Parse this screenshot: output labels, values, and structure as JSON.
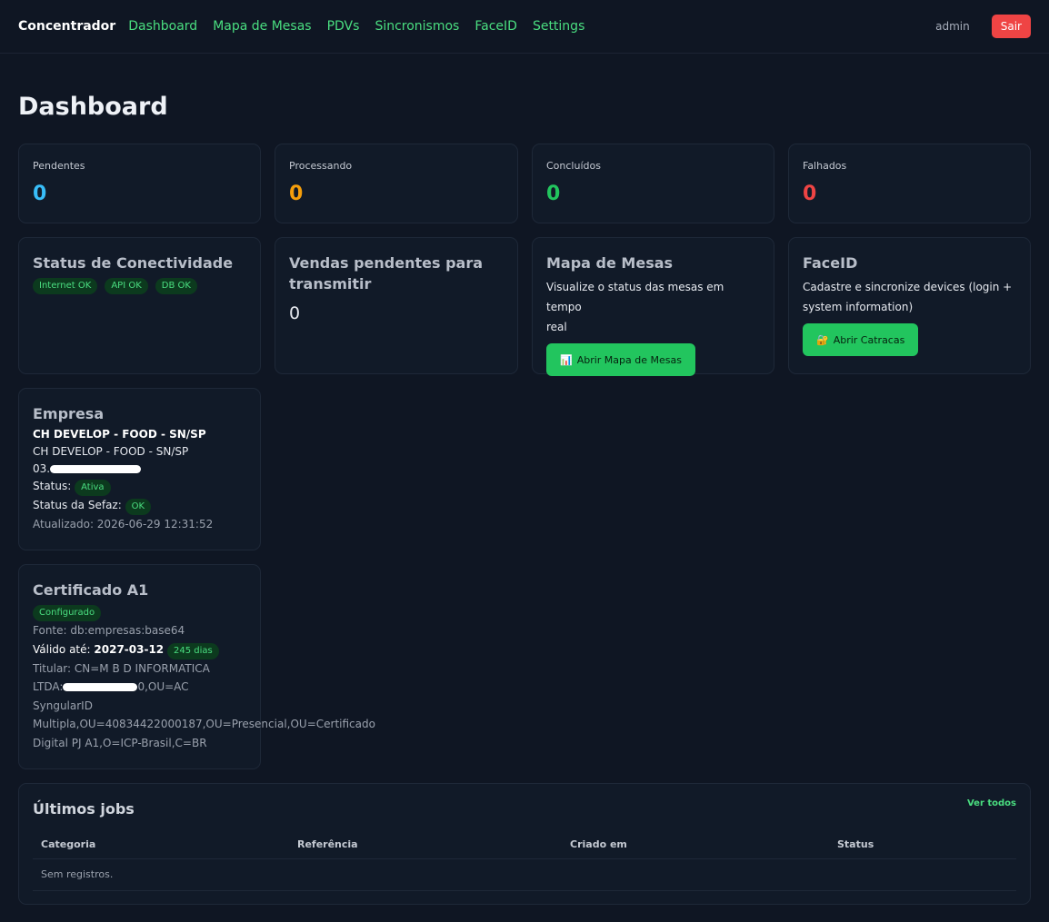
{
  "navbar": {
    "brand": "Concentrador",
    "links": [
      "Dashboard",
      "Mapa de Mesas",
      "PDVs",
      "Sincronismos",
      "FaceID",
      "Settings"
    ],
    "user": "admin",
    "logout_label": "Sair"
  },
  "page_title": "Dashboard",
  "stats": [
    {
      "label": "Pendentes",
      "value": "0",
      "color": "#38bdf8"
    },
    {
      "label": "Processando",
      "value": "0",
      "color": "#f59e0b"
    },
    {
      "label": "Concluídos",
      "value": "0",
      "color": "#22c55e"
    },
    {
      "label": "Falhados",
      "value": "0",
      "color": "#ef4444"
    }
  ],
  "connectivity": {
    "title": "Status de Conectividade",
    "badges": [
      "Internet OK",
      "API OK",
      "DB OK"
    ]
  },
  "pending_sales": {
    "title_line1": "Vendas pendentes para",
    "title_line2": "transmitir",
    "value": "0"
  },
  "tables_map": {
    "title": "Mapa de Mesas",
    "desc_line1": "Visualize o status das mesas em tempo",
    "desc_line2": "real",
    "button_label": "Abrir Mapa de Mesas",
    "button_icon": "bar-chart-icon"
  },
  "faceid": {
    "title": "FaceID",
    "desc_line1": "Cadastre e sincronize devices (login +",
    "desc_line2": "system information)",
    "button_label": "Abrir Catracas",
    "button_icon": "lock-icon"
  },
  "company": {
    "title": "Empresa",
    "name_bold": "CH DEVELOP - FOOD - SN/SP",
    "name": "CH DEVELOP - FOOD - SN/SP",
    "cnpj_visible_start": "03.",
    "status_label": "Status:",
    "status_badge": "Ativa",
    "sefaz_label": "Status da Sefaz:",
    "sefaz_badge": "OK",
    "updated": "Atualizado: 2026-06-29 12:31:52"
  },
  "certificate": {
    "title": "Certificado A1",
    "status_badge": "Configurado",
    "source": "Fonte: db:empresas:base64",
    "valid_label": "Válido até:",
    "valid_date": "2027-03-12",
    "days_badge": "245 dias",
    "holder_line1": "Titular: CN=M B D INFORMATICA",
    "holder_line2_start": "LTDA:",
    "holder_line2_end": "0,OU=AC",
    "holder_line3": "SyngularID",
    "holder_line4": "Multipla,OU=40834422000187,OU=Presencial,OU=Certificado",
    "holder_line5": "Digital PJ A1,O=ICP-Brasil,C=BR"
  },
  "jobs": {
    "title": "Últimos jobs",
    "view_all": "Ver todos",
    "columns": [
      "Categoria",
      "Referência",
      "Criado em",
      "Status"
    ],
    "empty": "Sem registros."
  },
  "colors": {
    "background": "#0f1623",
    "accent": "#4ade80",
    "button_green": "#22c55e",
    "danger": "#ef4444"
  }
}
